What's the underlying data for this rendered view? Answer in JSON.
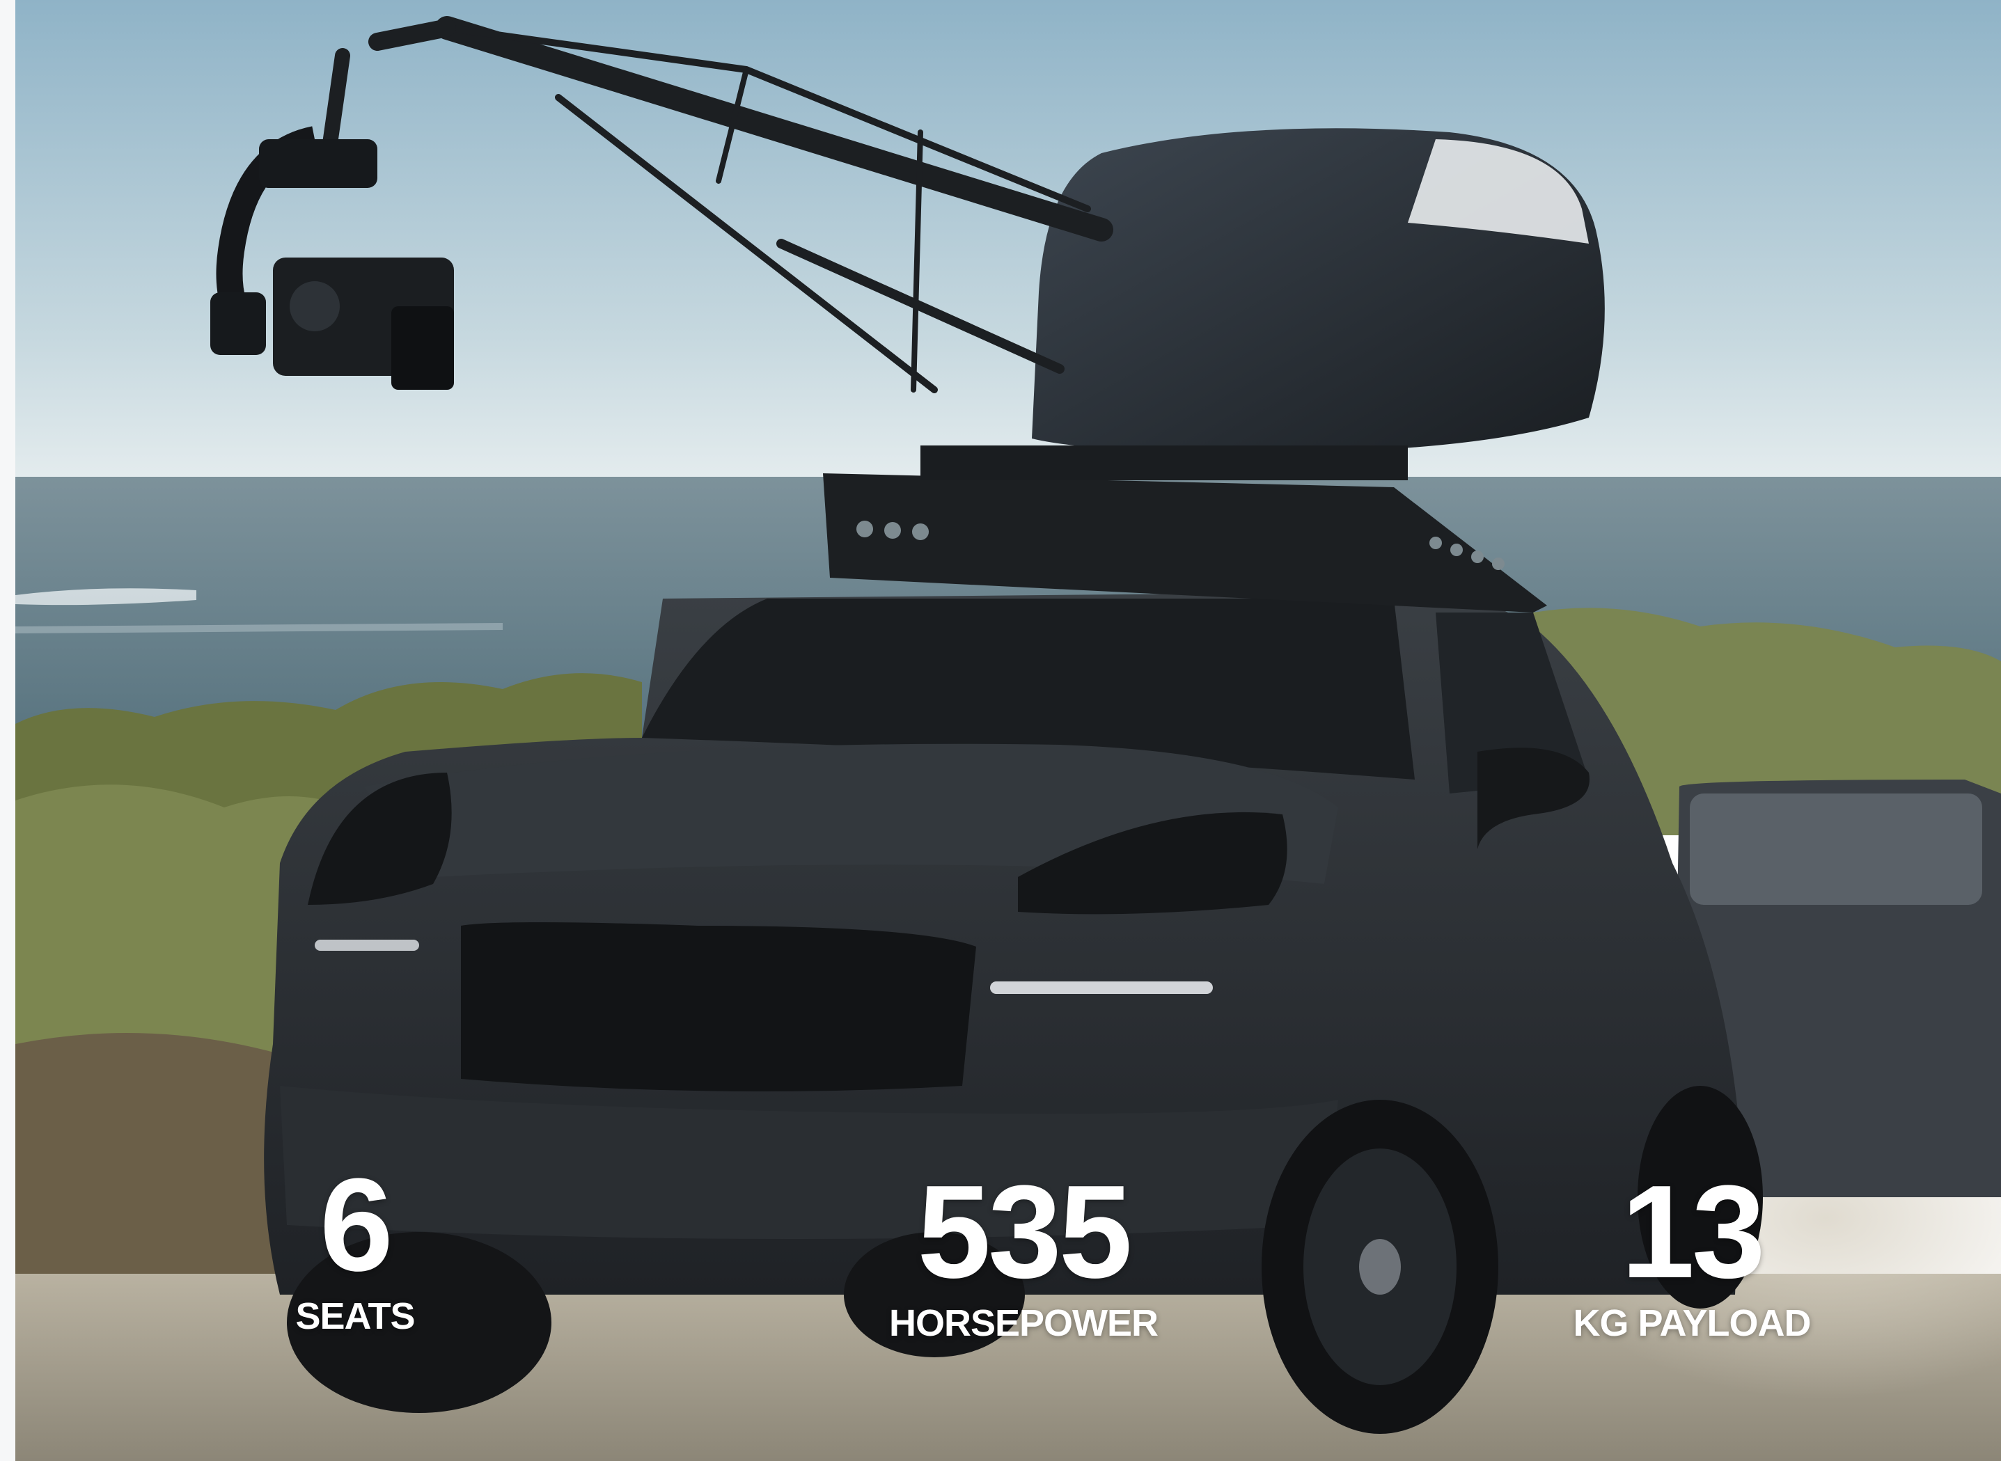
{
  "stats": [
    {
      "value": "6",
      "label": "SEATS"
    },
    {
      "value": "535",
      "label": "HORSEPOWER"
    },
    {
      "value": "13",
      "label": "KG PAYLOAD"
    }
  ],
  "colors": {
    "stat_text": "#ffffff",
    "sky_top": "#9ebccd",
    "sky_horizon": "#dbe6ea",
    "sea": "#5f7a86",
    "bush": "#6f7a3f",
    "ground": "#a49d8c",
    "vehicle": "#2b2f33"
  },
  "icons": [
    "camera-crane-icon"
  ]
}
